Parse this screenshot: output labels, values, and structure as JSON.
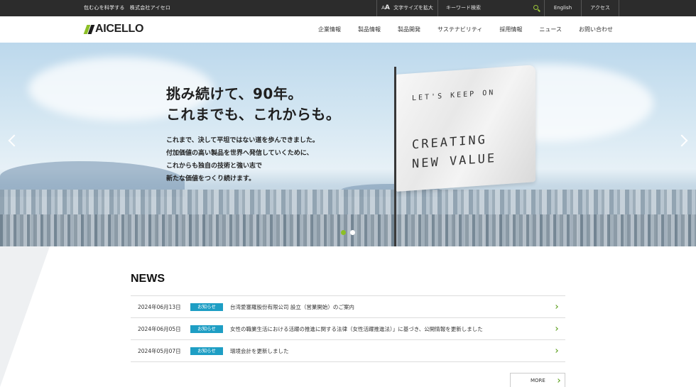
{
  "topbar": {
    "tagline": "包む心を科学する　株式会社アイセロ",
    "font_size_label": "文字サイズを拡大",
    "font_size_icon": "AA",
    "search_placeholder": "キーワード検索",
    "english": "English",
    "access": "アクセス"
  },
  "header": {
    "logo_text": "AICELLO",
    "nav": [
      "企業情報",
      "製品情報",
      "製品開発",
      "サステナビリティ",
      "採用情報",
      "ニュース",
      "お問い合わせ"
    ]
  },
  "hero": {
    "headline_1": "挑み続けて、90年。",
    "headline_2": "これまでも、これからも。",
    "lead_1": "これまで、決して平坦ではない道を歩んできました。",
    "lead_2": "付加価値の高い製品を世界へ発信していくために、",
    "lead_3": "これからも独自の技術と強い志で",
    "lead_4": "新たな価値をつくり続けます。",
    "flag_line_1": "LET'S KEEP ON",
    "flag_line_2": "CREATING",
    "flag_line_3": "NEW VALUE",
    "slide_count": 2,
    "active_slide": 1
  },
  "news": {
    "title": "NEWS",
    "items": [
      {
        "date": "2024年06月13日",
        "category": "お知らせ",
        "title": "台湾愛塞羅股份有限公司 設立（営業開始）のご案内"
      },
      {
        "date": "2024年06月05日",
        "category": "お知らせ",
        "title": "女性の職業生活における活躍の推進に関する法律（女性活躍推進法）」に基づき、公開情報を更新しました"
      },
      {
        "date": "2024年05月07日",
        "category": "お知らせ",
        "title": "環境会計を更新しました"
      }
    ],
    "more": "MORE"
  },
  "colors": {
    "accent_green": "#8cbf26",
    "badge_blue": "#1e9ec4",
    "topbar_bg": "#2c2c2c"
  }
}
